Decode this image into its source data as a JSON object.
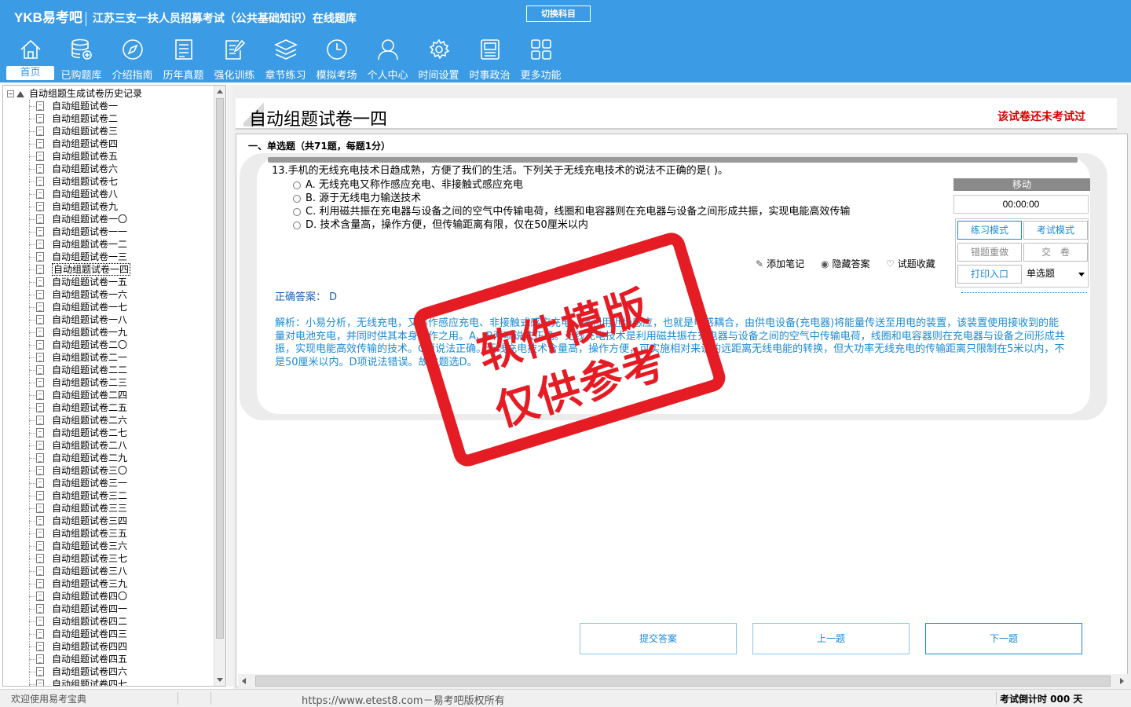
{
  "header": {
    "logo": "YKB易考吧",
    "title": "江苏三支一扶人员招募考试（公共基础知识）在线题库",
    "switch_subject": "切换科目"
  },
  "nav": [
    {
      "label": "首页",
      "icon": "home-icon"
    },
    {
      "label": "已购题库",
      "icon": "database-icon"
    },
    {
      "label": "介绍指南",
      "icon": "compass-icon"
    },
    {
      "label": "历年真题",
      "icon": "document-list-icon"
    },
    {
      "label": "强化训练",
      "icon": "edit-document-icon"
    },
    {
      "label": "章节练习",
      "icon": "layers-icon"
    },
    {
      "label": "模拟考场",
      "icon": "clock-icon"
    },
    {
      "label": "个人中心",
      "icon": "user-icon"
    },
    {
      "label": "时间设置",
      "icon": "gear-icon"
    },
    {
      "label": "时事政治",
      "icon": "newspaper-icon"
    },
    {
      "label": "更多功能",
      "icon": "grid-icon"
    }
  ],
  "tree": {
    "root": "自动组题生成试卷历史记录",
    "items": [
      "自动组题试卷一",
      "自动组题试卷二",
      "自动组题试卷三",
      "自动组题试卷四",
      "自动组题试卷五",
      "自动组题试卷六",
      "自动组题试卷七",
      "自动组题试卷八",
      "自动组题试卷九",
      "自动组题试卷一〇",
      "自动组题试卷一一",
      "自动组题试卷一二",
      "自动组题试卷一三",
      "自动组题试卷一四",
      "自动组题试卷一五",
      "自动组题试卷一六",
      "自动组题试卷一七",
      "自动组题试卷一八",
      "自动组题试卷一九",
      "自动组题试卷二〇",
      "自动组题试卷二一",
      "自动组题试卷二二",
      "自动组题试卷二三",
      "自动组题试卷二四",
      "自动组题试卷二五",
      "自动组题试卷二六",
      "自动组题试卷二七",
      "自动组题试卷二八",
      "自动组题试卷二九",
      "自动组题试卷三〇",
      "自动组题试卷三一",
      "自动组题试卷三二",
      "自动组题试卷三三",
      "自动组题试卷三四",
      "自动组题试卷三五",
      "自动组题试卷三六",
      "自动组题试卷三七",
      "自动组题试卷三八",
      "自动组题试卷三九",
      "自动组题试卷四〇",
      "自动组题试卷四一",
      "自动组题试卷四二",
      "自动组题试卷四三",
      "自动组题试卷四四",
      "自动组题试卷四五",
      "自动组题试卷四六",
      "自动组题试卷四七"
    ],
    "selected_index": 13
  },
  "paper": {
    "title": "自动组题试卷一四",
    "status": "该试卷还未考试过",
    "section": "一、单选题（共71题，每题1分）"
  },
  "question": {
    "text": "13.手机的无线充电技术日趋成熟，方便了我们的生活。下列关于无线充电技术的说法不正确的是( )。",
    "options": [
      "A. 无线充电又称作感应充电、非接触式感应充电",
      "B. 源于无线电力输送技术",
      "C. 利用磁共振在充电器与设备之间的空气中传输电荷，线圈和电容器则在充电器与设备之间形成共振，实现电能高效传输",
      "D. 技术含量高，操作方便，但传输距离有限，仅在50厘米以内"
    ],
    "tools": {
      "note": "添加笔记",
      "hide": "隐藏答案",
      "fav": "试题收藏"
    },
    "answer_label": "正确答案：",
    "answer_value": "D",
    "analysis": "解析：小易分析，无线充电，又称作感应充电、非接触式感应充电，是利用近场感应，也就是电感耦合，由供电设备(充电器)将能量传送至用电的装置，该装置使用接收到的能量对电池充电，并同时供其本身运作之用。A、B两项说法正确。无线充电技术是利用磁共振在充电器与设备之间的空气中传输电荷，线圈和电容器则在充电器与设备之间形成共振，实现电能高效传输的技术。C项说法正确。无线充电技术含量高，操作方便，可实施相对来说的远距离无线电能的转换，但大功率无线充电的传输距离只限制在5米以内，不是50厘米以内。D项说法错误。故本题选D。"
  },
  "panel": {
    "move": "移动",
    "timer": "00:00:00",
    "practice_mode": "练习模式",
    "exam_mode": "考试模式",
    "redo_wrong": "错题重做",
    "submit_paper": "交　卷",
    "print": "打印入口",
    "question_type": "单选题"
  },
  "buttons": {
    "submit": "提交答案",
    "prev": "上一题",
    "next": "下一题"
  },
  "stamp": {
    "line1": "软件模版",
    "line2": "仅供参考"
  },
  "status": {
    "welcome": "欢迎使用易考宝典",
    "url": "https://www.etest8.com－易考吧版权所有",
    "countdown": "考试倒计时 000 天"
  }
}
